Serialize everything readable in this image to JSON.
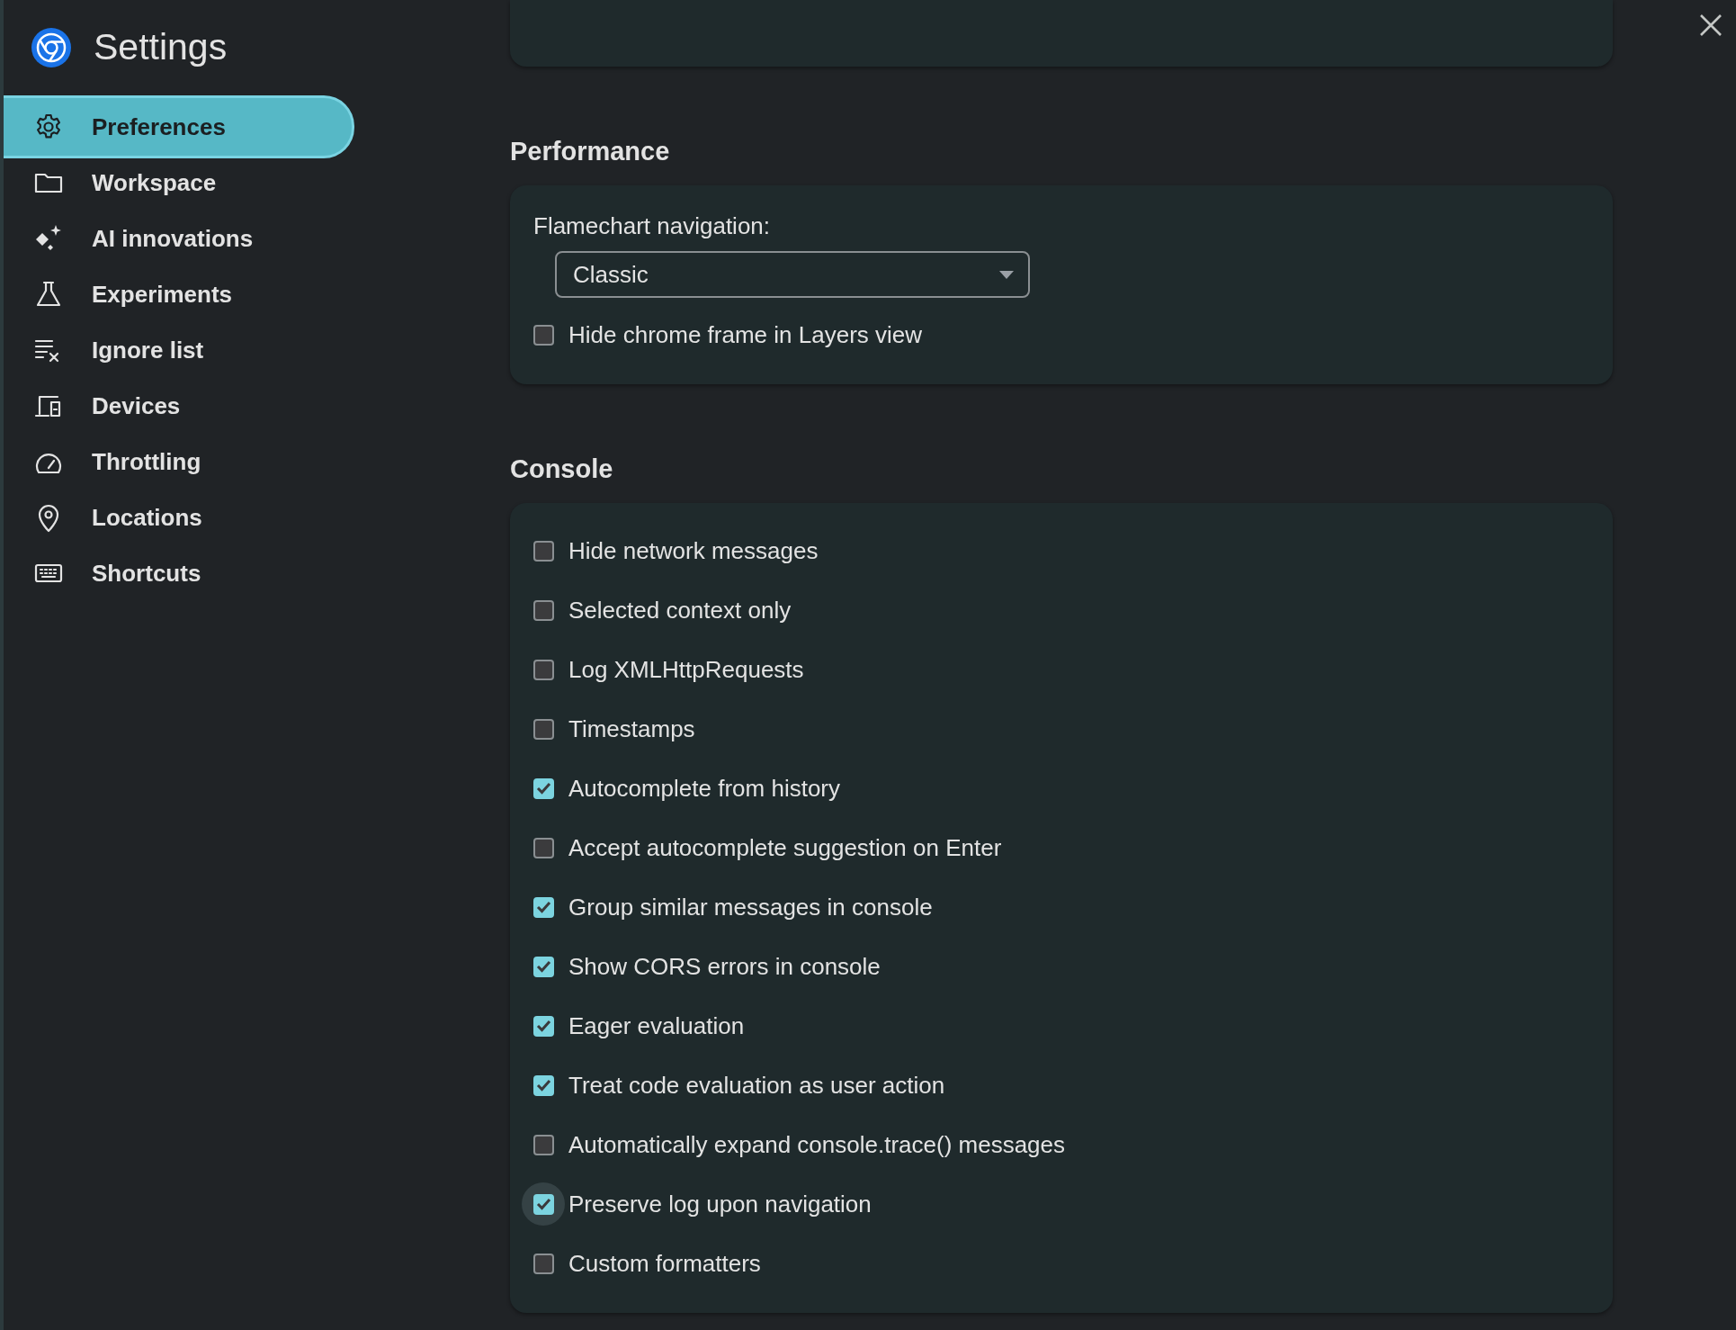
{
  "window": {
    "title": "Settings"
  },
  "sidebar": {
    "items": [
      {
        "label": "Preferences",
        "selected": true
      },
      {
        "label": "Workspace",
        "selected": false
      },
      {
        "label": "AI innovations",
        "selected": false
      },
      {
        "label": "Experiments",
        "selected": false
      },
      {
        "label": "Ignore list",
        "selected": false
      },
      {
        "label": "Devices",
        "selected": false
      },
      {
        "label": "Throttling",
        "selected": false
      },
      {
        "label": "Locations",
        "selected": false
      },
      {
        "label": "Shortcuts",
        "selected": false
      }
    ]
  },
  "sections": [
    {
      "title": "Performance",
      "dropdown": {
        "label": "Flamechart navigation:",
        "value": "Classic"
      },
      "options": [
        {
          "label": "Hide chrome frame in Layers view",
          "checked": false,
          "focused": false
        }
      ]
    },
    {
      "title": "Console",
      "options": [
        {
          "label": "Hide network messages",
          "checked": false,
          "focused": false
        },
        {
          "label": "Selected context only",
          "checked": false,
          "focused": false
        },
        {
          "label": "Log XMLHttpRequests",
          "checked": false,
          "focused": false
        },
        {
          "label": "Timestamps",
          "checked": false,
          "focused": false
        },
        {
          "label": "Autocomplete from history",
          "checked": true,
          "focused": false
        },
        {
          "label": "Accept autocomplete suggestion on Enter",
          "checked": false,
          "focused": false
        },
        {
          "label": "Group similar messages in console",
          "checked": true,
          "focused": false
        },
        {
          "label": "Show CORS errors in console",
          "checked": true,
          "focused": false
        },
        {
          "label": "Eager evaluation",
          "checked": true,
          "focused": false
        },
        {
          "label": "Treat code evaluation as user action",
          "checked": true,
          "focused": false
        },
        {
          "label": "Automatically expand console.trace() messages",
          "checked": false,
          "focused": false
        },
        {
          "label": "Preserve log upon navigation",
          "checked": true,
          "focused": true
        },
        {
          "label": "Custom formatters",
          "checked": false,
          "focused": false
        }
      ]
    }
  ]
}
